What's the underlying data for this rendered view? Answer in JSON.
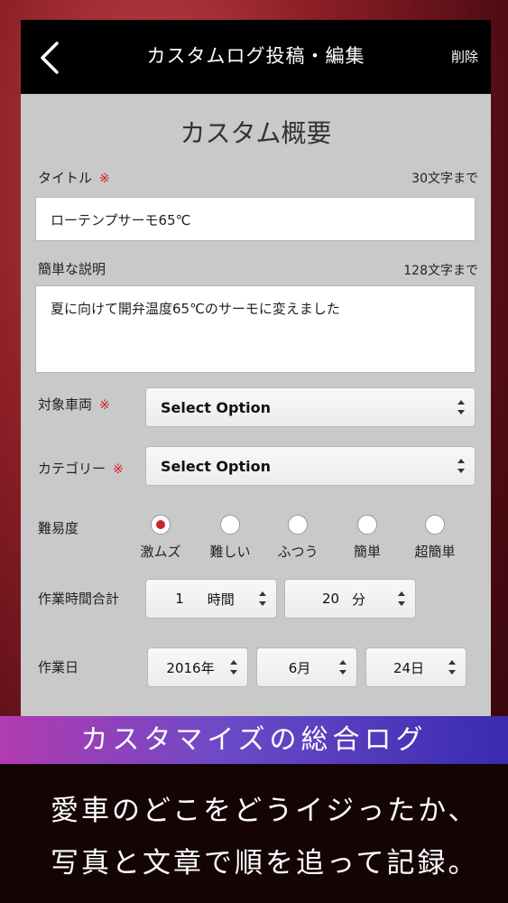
{
  "nav": {
    "title": "カスタムログ投稿・編集",
    "delete_label": "削除"
  },
  "section_title": "カスタム概要",
  "title_field": {
    "label": "タイトル",
    "required_mark": "※",
    "limit": "30文字まで",
    "value": "ローテンプサーモ65℃"
  },
  "description_field": {
    "label": "簡単な説明",
    "limit": "128文字まで",
    "value": "夏に向けて開弁温度65℃のサーモに変えました"
  },
  "vehicle_field": {
    "label": "対象車両",
    "required_mark": "※",
    "value": "Select Option"
  },
  "category_field": {
    "label": "カテゴリー",
    "required_mark": "※",
    "value": "Select Option"
  },
  "difficulty": {
    "label": "難易度",
    "options": [
      "激ムズ",
      "難しい",
      "ふつう",
      "簡単",
      "超簡単"
    ],
    "selected": "激ムズ"
  },
  "work_time": {
    "label": "作業時間合計",
    "hours": "1",
    "hours_unit": "時間",
    "minutes": "20",
    "minutes_unit": "分"
  },
  "work_date": {
    "label": "作業日",
    "year": "2016年",
    "month": "6月",
    "day": "24日"
  },
  "banner": "カスタマイズの総合ログ",
  "caption": {
    "line1": "愛車のどこをどうイジったか、",
    "line2": "写真と文章で順を追って記録。"
  },
  "colors": {
    "accent": "#d0212a",
    "nav_bg": "#000000",
    "form_bg": "#c9c9c9"
  }
}
